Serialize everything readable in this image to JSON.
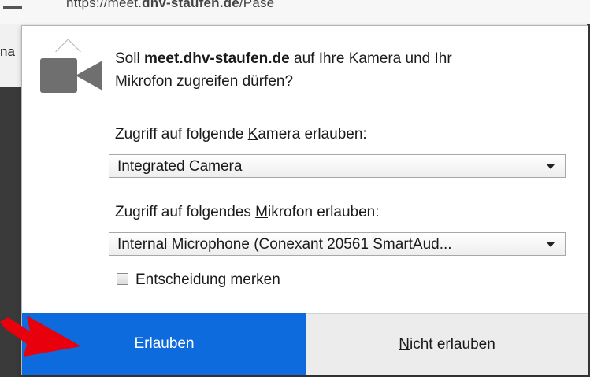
{
  "background": {
    "url_text_prefix": "https://meet.",
    "url_text_bold": "dhv-staufen.de",
    "url_text_suffix": "/Pase",
    "left_text": "na"
  },
  "dialog": {
    "question_prefix": "Soll ",
    "question_host": "meet.dhv-staufen.de",
    "question_suffix_line1": " auf Ihre Kamera und Ihr",
    "question_line2": "Mikrofon zugreifen dürfen?",
    "camera": {
      "label_before": "Zugriff auf folgende ",
      "label_access_key": "K",
      "label_after": "amera erlauben:",
      "selected": "Integrated Camera"
    },
    "microphone": {
      "label_before": "Zugriff auf folgendes ",
      "label_access_key": "M",
      "label_after": "ikrofon erlauben:",
      "selected": "Internal Microphone (Conexant 20561 SmartAud..."
    },
    "remember": {
      "label": "Entscheidung merken",
      "checked": false
    },
    "buttons": {
      "allow_key": "E",
      "allow_rest": "rlauben",
      "deny_key": "N",
      "deny_rest": "icht erlauben"
    }
  },
  "colors": {
    "allow_button": "#0d6bdd",
    "deny_button": "#ececec",
    "annotation_arrow": "#e8000d",
    "camera_icon": "#6f6f6f"
  },
  "icons": {
    "camera": "camera-icon",
    "dropdown": "chevron-down-icon",
    "annotation": "red-arrow-icon"
  }
}
